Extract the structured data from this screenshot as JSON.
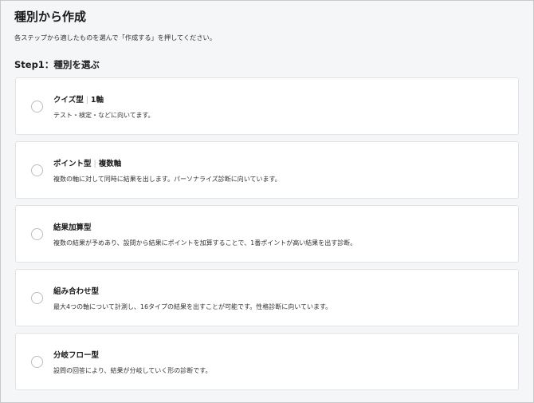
{
  "header": {
    "title": "種別から作成",
    "description": "各ステップから適したものを選んで「作成する」を押してください。"
  },
  "step1": {
    "title": "Step1：種別を選ぶ",
    "options": [
      {
        "name": "クイズ型",
        "axis": "1軸",
        "description": "テスト・検定・などに向いてます。"
      },
      {
        "name": "ポイント型",
        "axis": "複数軸",
        "description": "複数の軸に対して同時に結果を出します。パーソナライズ診断に向いています。"
      },
      {
        "name": "結果加算型",
        "axis": "",
        "description": "複数の結果が予めあり、設問から結果にポイントを加算することで、1番ポイントが高い結果を出す診断。"
      },
      {
        "name": "組み合わせ型",
        "axis": "",
        "description": "最大4つの軸について計測し、16タイプの結果を出すことが可能です。性格診断に向いています。"
      },
      {
        "name": "分岐フロー型",
        "axis": "",
        "description": "設問の回答により、結果が分岐していく形の診断です。"
      }
    ]
  }
}
